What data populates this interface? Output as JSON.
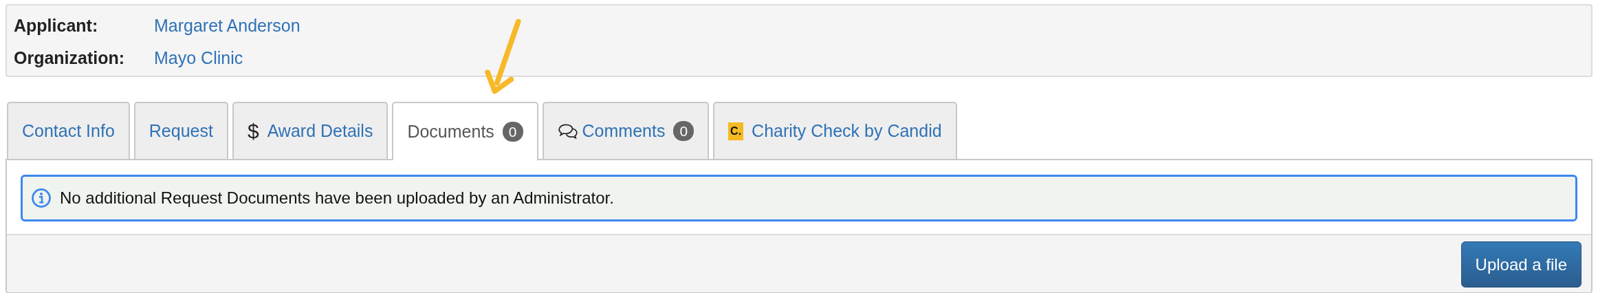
{
  "applicant_info": [
    {
      "label": "Applicant:",
      "value": "Margaret Anderson"
    },
    {
      "label": "Organization:",
      "value": "Mayo Clinic"
    }
  ],
  "tabs": [
    {
      "label": "Contact Info",
      "selected": false
    },
    {
      "label": "Request",
      "selected": false
    },
    {
      "label": "Award Details",
      "selected": false,
      "icon": "$"
    },
    {
      "label": "Documents",
      "selected": true,
      "count": "0"
    },
    {
      "label": "Comments",
      "selected": false,
      "kind": "comments",
      "count": "0"
    },
    {
      "label": "Charity Check by Candid",
      "selected": false,
      "logo": "C."
    }
  ],
  "annotation": {
    "kind": "arrow"
  },
  "alert": {
    "kind": "info",
    "message": "No additional Request Documents have been uploaded by an Administrator."
  },
  "buttons": [
    "Upload a file"
  ]
}
